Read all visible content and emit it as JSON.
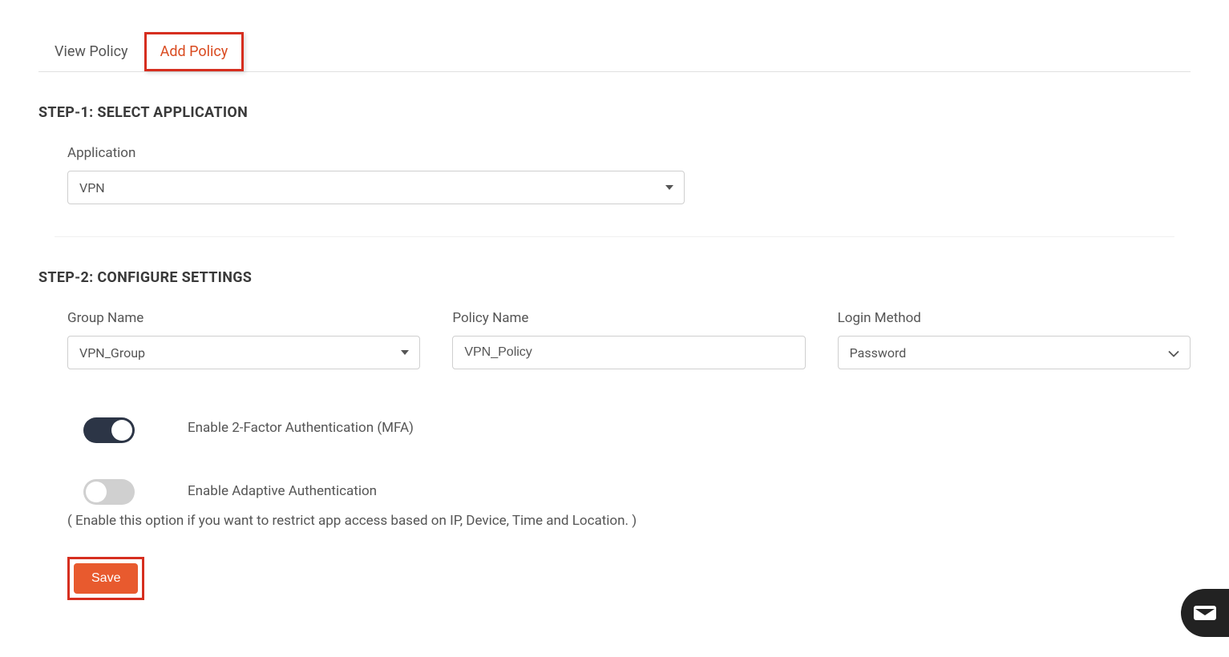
{
  "tabs": {
    "view_policy": "View Policy",
    "add_policy": "Add Policy"
  },
  "step1": {
    "heading": "STEP-1: SELECT APPLICATION",
    "application_label": "Application",
    "application_value": "VPN"
  },
  "step2": {
    "heading": "STEP-2: CONFIGURE SETTINGS",
    "group_name_label": "Group Name",
    "group_name_value": "VPN_Group",
    "policy_name_label": "Policy Name",
    "policy_name_value": "VPN_Policy",
    "login_method_label": "Login Method",
    "login_method_value": "Password",
    "mfa_label": "Enable 2-Factor Authentication (MFA)",
    "adaptive_label": "Enable Adaptive Authentication",
    "adaptive_desc": "( Enable this option if you want to restrict app access based on IP, Device, Time and Location. )"
  },
  "actions": {
    "save": "Save"
  }
}
